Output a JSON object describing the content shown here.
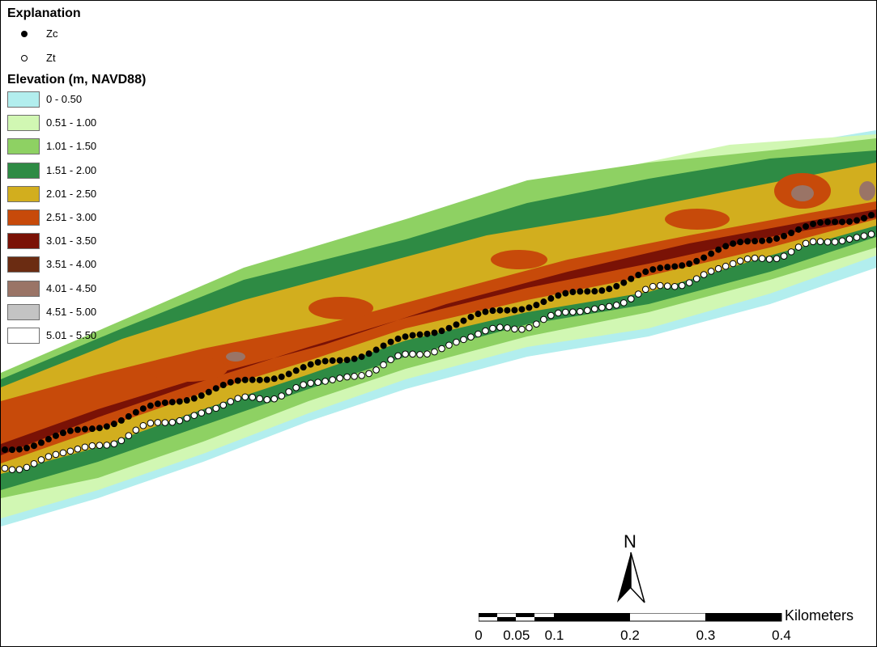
{
  "legend": {
    "explanation_title": "Explanation",
    "points": [
      {
        "label": "Zc",
        "symbol": "filled-circle-black"
      },
      {
        "label": "Zt",
        "symbol": "open-circle-white"
      }
    ],
    "elevation_title": "Elevation (m, NAVD88)",
    "classes": [
      {
        "label": "0 - 0.50",
        "color": "#b2eeee"
      },
      {
        "label": "0.51 - 1.00",
        "color": "#d1f7b3"
      },
      {
        "label": "1.01 - 1.50",
        "color": "#8ed163"
      },
      {
        "label": "1.51 - 2.00",
        "color": "#2e8b44"
      },
      {
        "label": "2.01 - 2.50",
        "color": "#d2ae1e"
      },
      {
        "label": "2.51 - 3.00",
        "color": "#c74a0a"
      },
      {
        "label": "3.01 - 3.50",
        "color": "#7a1206"
      },
      {
        "label": "3.51 - 4.00",
        "color": "#6b2c12"
      },
      {
        "label": "4.01 - 4.50",
        "color": "#9a7466"
      },
      {
        "label": "4.51 - 5.00",
        "color": "#c3c3c3"
      },
      {
        "label": "5.01 - 5.50",
        "color": "#ffffff"
      }
    ]
  },
  "north_arrow": {
    "letter": "N",
    "icon": "north-arrow-icon"
  },
  "scale_bar": {
    "units": "Kilometers",
    "ticks": [
      "0",
      "0.05",
      "0.1",
      "0.2",
      "0.3",
      "0.4"
    ],
    "tick_values": [
      0,
      0.05,
      0.1,
      0.2,
      0.3,
      0.4
    ]
  }
}
